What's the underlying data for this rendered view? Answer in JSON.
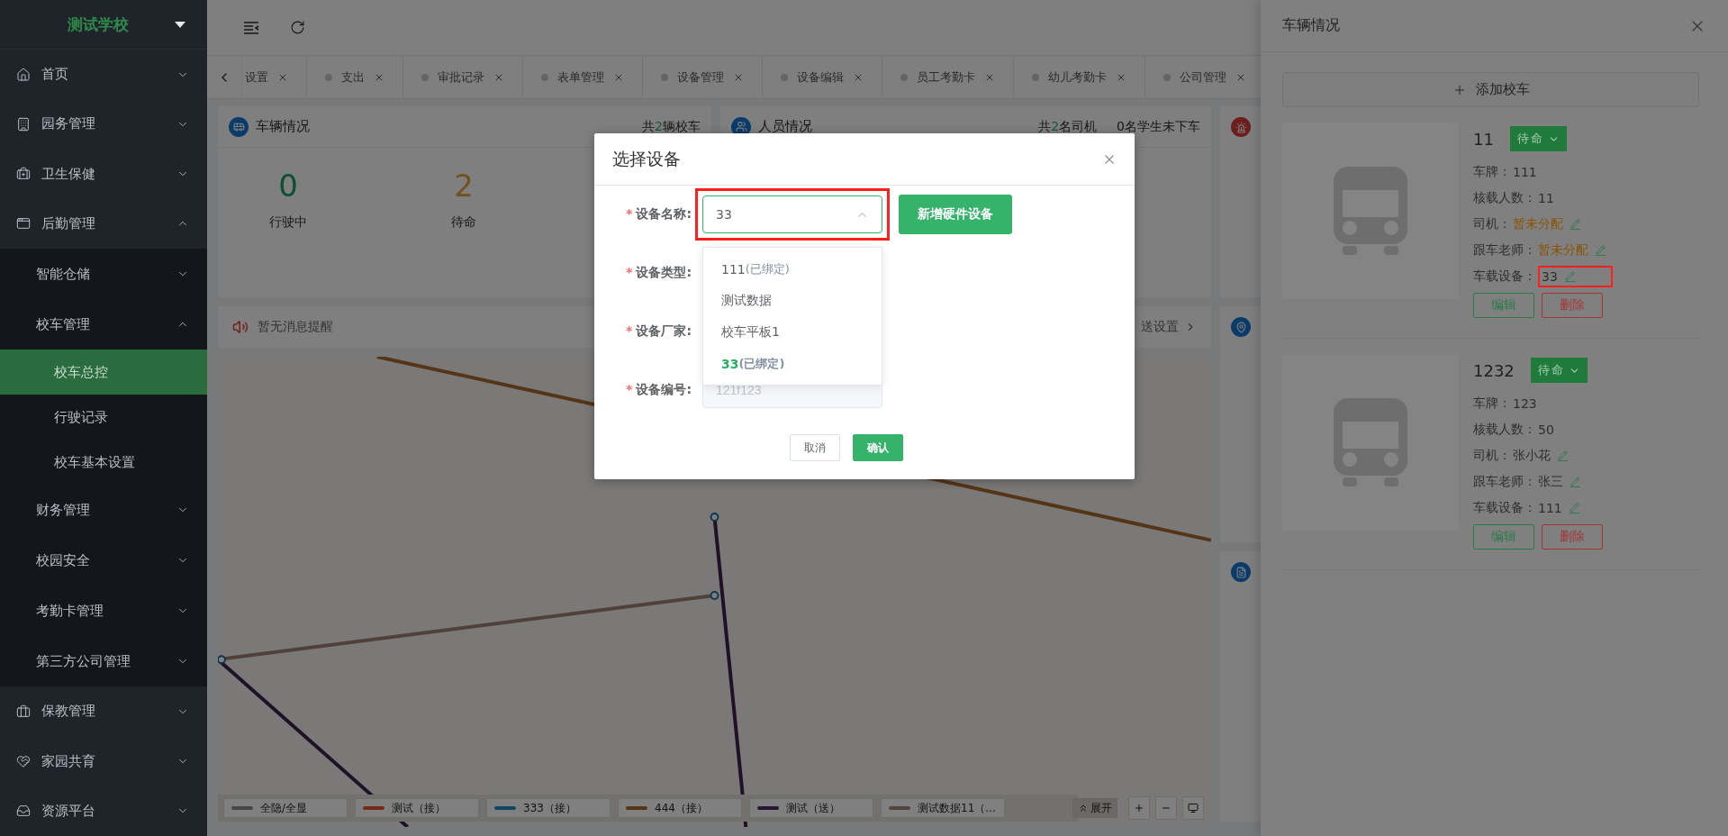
{
  "sidebar": {
    "school": "测试学校",
    "items": [
      {
        "label": "首页",
        "expanded": false
      },
      {
        "label": "园务管理",
        "expanded": false
      },
      {
        "label": "卫生保健",
        "expanded": false
      },
      {
        "label": "后勤管理",
        "expanded": true,
        "children": [
          {
            "label": "智能仓储",
            "expanded": false
          },
          {
            "label": "校车管理",
            "expanded": true,
            "children": [
              {
                "label": "校车总控",
                "selected": true
              },
              {
                "label": "行驶记录",
                "selected": false
              },
              {
                "label": "校车基本设置",
                "selected": false
              }
            ]
          },
          {
            "label": "财务管理",
            "expanded": false
          },
          {
            "label": "校园安全",
            "expanded": false
          },
          {
            "label": "考勤卡管理",
            "expanded": false
          },
          {
            "label": "第三方公司管理",
            "expanded": false
          }
        ]
      },
      {
        "label": "保教管理",
        "expanded": false
      },
      {
        "label": "家园共育",
        "expanded": false
      },
      {
        "label": "资源平台",
        "expanded": false
      }
    ]
  },
  "tabs": [
    {
      "label": "设置",
      "selected": false
    },
    {
      "label": "支出",
      "selected": false
    },
    {
      "label": "审批记录",
      "selected": false
    },
    {
      "label": "表单管理",
      "selected": false
    },
    {
      "label": "设备管理",
      "selected": false
    },
    {
      "label": "设备编辑",
      "selected": false
    },
    {
      "label": "员工考勤卡",
      "selected": false
    },
    {
      "label": "幼儿考勤卡",
      "selected": false
    },
    {
      "label": "公司管理",
      "selected": false
    }
  ],
  "vehicle_card": {
    "title": "车辆情况",
    "summary": {
      "before": "共",
      "count": "2",
      "after": "辆校车"
    },
    "stats": [
      {
        "value": "0",
        "label": "行驶中",
        "kind": "running"
      },
      {
        "value": "2",
        "label": "待命",
        "kind": "standby"
      }
    ]
  },
  "staff_card": {
    "title": "人员情况",
    "summary": {
      "before": "共",
      "count": "2",
      "after": "名司机"
    },
    "note": "0名学生未下车"
  },
  "message_bar": {
    "text": "暂无消息提醒",
    "link": "送设置"
  },
  "map": {
    "legend": [
      {
        "label": "全隐/全显",
        "color": "#464646"
      },
      {
        "label": "测试（接）",
        "color": "#712c15"
      },
      {
        "label": "333（接）",
        "color": "#0e4860"
      },
      {
        "label": "444（接）",
        "color": "#543516"
      },
      {
        "label": "测试（送）",
        "color": "#251635"
      },
      {
        "label": "测试数据11（...",
        "color": "#54423c"
      }
    ],
    "expand": "展开"
  },
  "drawer": {
    "title": "车辆情况",
    "add_button": "添加校车",
    "vehicles": [
      {
        "name": "11",
        "status": "待命",
        "fields": [
          {
            "label": "车牌：",
            "value": "111",
            "unassigned": false,
            "editable": false,
            "annotated": false
          },
          {
            "label": "核载人数：",
            "value": "11",
            "unassigned": false,
            "editable": false,
            "annotated": false
          },
          {
            "label": "司机：",
            "value": "暂未分配",
            "unassigned": true,
            "editable": true,
            "annotated": false
          },
          {
            "label": "跟车老师：",
            "value": "暂未分配",
            "unassigned": true,
            "editable": true,
            "annotated": false
          },
          {
            "label": "车载设备：",
            "value": "33",
            "unassigned": false,
            "editable": true,
            "annotated": true
          }
        ],
        "actions": [
          {
            "label": "编辑",
            "kind": "edit"
          },
          {
            "label": "删除",
            "kind": "delete"
          }
        ]
      },
      {
        "name": "1232",
        "status": "待命",
        "fields": [
          {
            "label": "车牌：",
            "value": "123",
            "unassigned": false,
            "editable": false,
            "annotated": false
          },
          {
            "label": "核载人数：",
            "value": "50",
            "unassigned": false,
            "editable": false,
            "annotated": false
          },
          {
            "label": "司机：",
            "value": "张小花",
            "unassigned": false,
            "editable": true,
            "annotated": false
          },
          {
            "label": "跟车老师：",
            "value": "张三",
            "unassigned": false,
            "editable": true,
            "annotated": false
          },
          {
            "label": "车载设备：",
            "value": "111",
            "unassigned": false,
            "editable": true,
            "annotated": false
          }
        ],
        "actions": [
          {
            "label": "编辑",
            "kind": "edit"
          },
          {
            "label": "删除",
            "kind": "delete"
          }
        ]
      }
    ]
  },
  "modal": {
    "title": "选择设备",
    "add_button": "新增硬件设备",
    "fields": [
      {
        "asterisk": "*",
        "label": "设备名称:",
        "kind": "select",
        "value": "33",
        "expanded": true,
        "annotated": true,
        "options": [
          {
            "text": "111",
            "note": "(已绑定)",
            "selected": false
          },
          {
            "text": "测试数据",
            "selected": false
          },
          {
            "text": "校车平板1",
            "selected": false
          },
          {
            "text": "33",
            "note": "(已绑定)",
            "selected": true
          }
        ]
      },
      {
        "asterisk": "*",
        "label": "设备类型:",
        "kind": "label"
      },
      {
        "asterisk": "*",
        "label": "设备厂家:",
        "kind": "label"
      },
      {
        "asterisk": "*",
        "label": "设备编号:",
        "kind": "input",
        "value": "121f123",
        "disabled": true
      }
    ],
    "buttons": [
      {
        "label": "取消",
        "kind": "default"
      },
      {
        "label": "确认",
        "kind": "primary"
      }
    ]
  }
}
